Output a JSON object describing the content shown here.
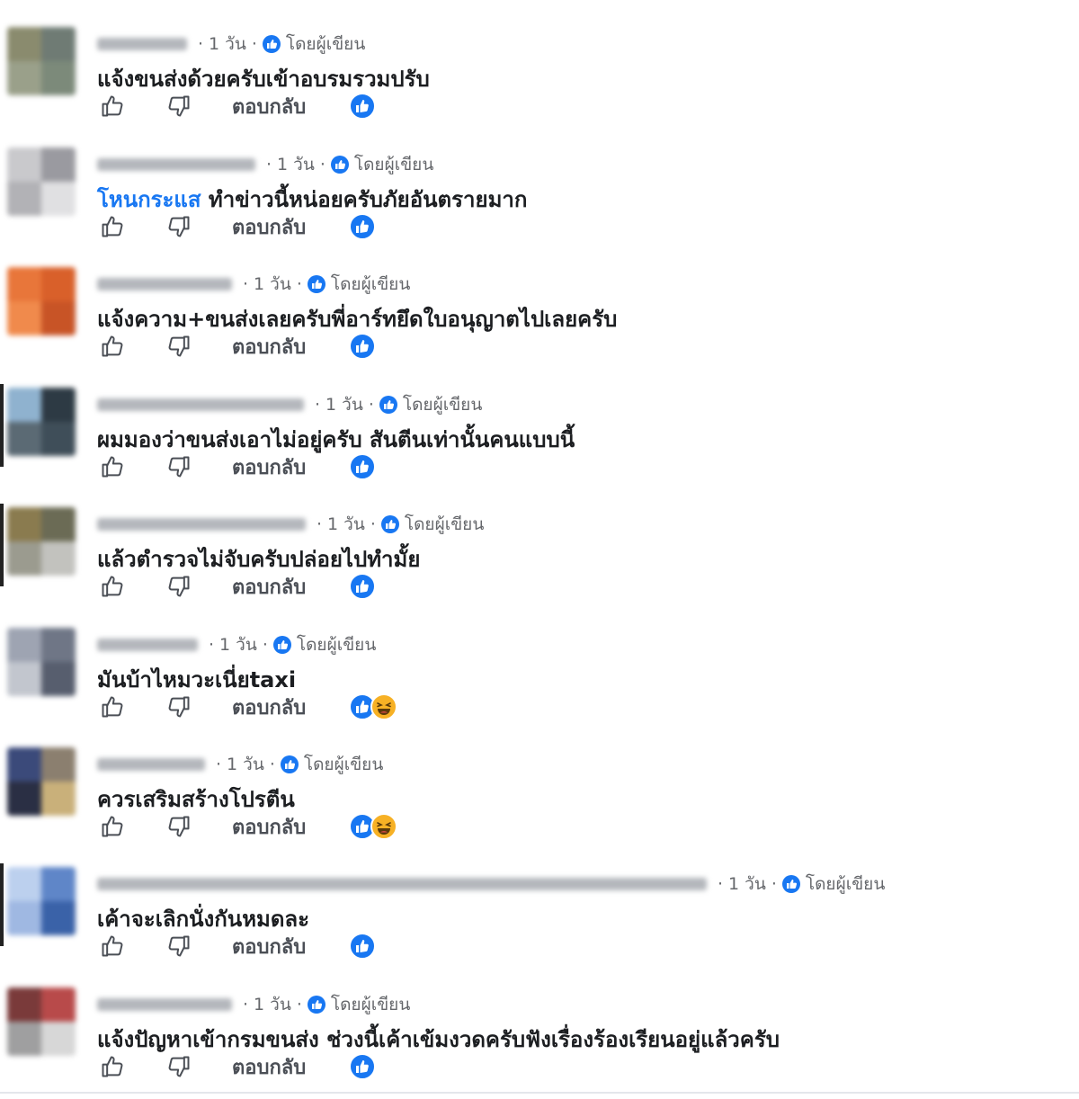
{
  "comments": [
    {
      "time": "1 วัน",
      "author_badge": "โดยผู้เขียน",
      "mention": "",
      "text": "แจ้งขนส่งด้วยครับเข้าอบรมรวมปรับ",
      "reply_label": "ตอบกลับ",
      "reactions": [
        "like"
      ]
    },
    {
      "time": "1 วัน",
      "author_badge": "โดยผู้เขียน",
      "mention": "โหนกระแส",
      "text": "ทำข่าวนี้หน่อยครับภัยอันตรายมาก",
      "reply_label": "ตอบกลับ",
      "reactions": [
        "like"
      ]
    },
    {
      "time": "1 วัน",
      "author_badge": "โดยผู้เขียน",
      "mention": "",
      "text": "แจ้งความ+ขนส่งเลยครับพี่อาร์ทยึดใบอนุญาตไปเลยครับ",
      "reply_label": "ตอบกลับ",
      "reactions": [
        "like"
      ]
    },
    {
      "time": "1 วัน",
      "author_badge": "โดยผู้เขียน",
      "mention": "",
      "text": "ผมมองว่าขนส่งเอาไม่อยู่ครับ สันตีนเท่านั้นคนแบบนี้",
      "reply_label": "ตอบกลับ",
      "reactions": [
        "like"
      ]
    },
    {
      "time": "1 วัน",
      "author_badge": "โดยผู้เขียน",
      "mention": "",
      "text": "แล้วตำรวจไม่จับครับปล่อยไปทำมั้ย",
      "reply_label": "ตอบกลับ",
      "reactions": [
        "like"
      ]
    },
    {
      "time": "1 วัน",
      "author_badge": "โดยผู้เขียน",
      "mention": "",
      "text": "มันบ้าไหมวะเนี่ยtaxi",
      "reply_label": "ตอบกลับ",
      "reactions": [
        "like",
        "haha"
      ]
    },
    {
      "time": "1 วัน",
      "author_badge": "โดยผู้เขียน",
      "mention": "",
      "text": "ควรเสริมสร้างโปรตีน",
      "reply_label": "ตอบกลับ",
      "reactions": [
        "like",
        "haha"
      ]
    },
    {
      "time": "1 วัน",
      "author_badge": "โดยผู้เขียน",
      "mention": "",
      "text": "เค้าจะเลิกนั่งกันหมดละ",
      "reply_label": "ตอบกลับ",
      "reactions": [
        "like"
      ]
    },
    {
      "time": "1 วัน",
      "author_badge": "โดยผู้เขียน",
      "mention": "",
      "text": "แจ้งปัญหาเข้ากรมขนส่ง ช่วงนี้เค้าเข้มงวดครับฟังเรื่องร้องเรียนอยู่แล้วครับ",
      "reply_label": "ตอบกลับ",
      "reactions": [
        "like"
      ]
    }
  ],
  "icons": {
    "like_action": "thumbs-up-outline-icon",
    "dislike_action": "thumbs-down-outline-icon",
    "author_badge": "author-badge-icon",
    "reaction_like": "like-reaction-icon",
    "reaction_haha": "haha-reaction-icon"
  },
  "colors": {
    "brand_blue": "#1877f2",
    "haha_yellow": "#f7b125",
    "meta_gray": "#65676b"
  }
}
